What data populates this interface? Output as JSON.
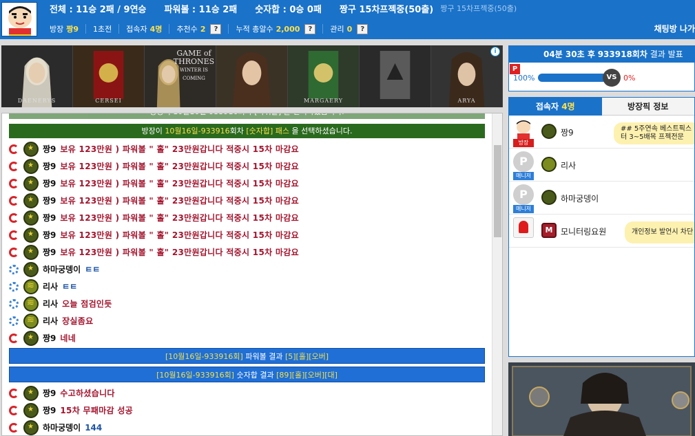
{
  "header": {
    "stats": {
      "total": "전체 : 11승 2패 / 9연승",
      "powerball": "파워볼 : 11승 2패",
      "numbers": "숫자합 : 0승 0패",
      "highlight": "짱구 15차프젝중(50출)",
      "highlight_dim": "짱구 15차프젝중(50출)"
    },
    "info": {
      "host_label": "방장",
      "host_name": "짱9",
      "class_label": "1초전",
      "users_label": "접속자",
      "users_value": "4명",
      "recommend_label": "추천수",
      "recommend_value": "2",
      "gift_label": "누적 총알수",
      "gift_value": "2,000",
      "manage_label": "관리",
      "manage_value": "0",
      "help_glyph": "?"
    },
    "chat_room_label": "채팅방 나가"
  },
  "ad": {
    "title_line1": "GAME of",
    "title_line2": "THRONES",
    "subtitle": "WINTER IS COMING",
    "characters": [
      "DAENERYS",
      "CERSEI",
      "MARGAERY",
      "ARYA"
    ],
    "info_glyph": "i"
  },
  "chat": {
    "system_top": "방장이 10월16일-933916회차 [파워볼] 을 선택하셨습니다.",
    "system": {
      "prefix": "방장이 ",
      "round": "10월16일-933916",
      "mid": "회차 ",
      "choice": "[숫자합] 패스",
      "suffix": " 을 선택하셨습니다."
    },
    "messages": [
      {
        "icon": "red",
        "rank": "star",
        "nick": "짱9",
        "text": "보유 123만원 ) 파워볼 \" 홀\" 23만원갑니다 적중시 15차 마감요",
        "style": "r"
      },
      {
        "icon": "red",
        "rank": "star",
        "nick": "짱9",
        "text": "보유 123만원 ) 파워볼 \" 홀\" 23만원갑니다 적중시 15차 마감요",
        "style": "r"
      },
      {
        "icon": "red",
        "rank": "star",
        "nick": "짱9",
        "text": "보유 123만원 ) 파워볼 \" 홀\" 23만원갑니다 적중시 15차 마감요",
        "style": "r"
      },
      {
        "icon": "red",
        "rank": "star",
        "nick": "짱9",
        "text": "보유 123만원 ) 파워볼 \" 홀\" 23만원갑니다 적중시 15차 마감요",
        "style": "r"
      },
      {
        "icon": "red",
        "rank": "star",
        "nick": "짱9",
        "text": "보유 123만원 ) 파워볼 \" 홀\" 23만원갑니다 적중시 15차 마감요",
        "style": "r"
      },
      {
        "icon": "red",
        "rank": "star",
        "nick": "짱9",
        "text": "보유 123만원 ) 파워볼 \" 홀\" 23만원갑니다 적중시 15차 마감요",
        "style": "r"
      },
      {
        "icon": "red",
        "rank": "star",
        "nick": "짱9",
        "text": "보유 123만원 ) 파워볼 \" 홀\" 23만원갑니다 적중시 15차 마감요",
        "style": "r"
      },
      {
        "icon": "blue",
        "rank": "star",
        "nick": "하마궁뎅이",
        "text": "ㅌㅌ",
        "style": "b"
      },
      {
        "icon": "blue",
        "rank": "chevron",
        "nick": "리사",
        "text": "ㅌㅌ",
        "style": "b"
      },
      {
        "icon": "blue",
        "rank": "chevron",
        "nick": "리사",
        "text": "오늘 점검인듯",
        "style": "r"
      },
      {
        "icon": "blue",
        "rank": "chevron",
        "nick": "리사",
        "text": "장실좀요",
        "style": "r"
      },
      {
        "icon": "red",
        "rank": "star",
        "nick": "짱9",
        "text": "네네",
        "style": "r"
      }
    ],
    "results": [
      {
        "round": "[10월16일-933916회]",
        "label": " 파워볼 결과 ",
        "num": "[5]",
        "odd": "[홀]",
        "size": "[오버]",
        "extra": ""
      },
      {
        "round": "[10월16일-933916회]",
        "label": " 숫자합 결과 ",
        "num": "[89]",
        "odd": "[홀]",
        "size": "[오버]",
        "extra": "[대]"
      }
    ],
    "messages2": [
      {
        "icon": "red",
        "rank": "star",
        "nick": "짱9",
        "text": "수고하셨습니다",
        "style": "r"
      },
      {
        "icon": "red",
        "rank": "star",
        "nick": "짱9",
        "text": "15차 무패마감 성공",
        "style": "r"
      },
      {
        "icon": "red",
        "rank": "star",
        "nick": "하마궁뎅이",
        "text": "144",
        "style": "b"
      }
    ]
  },
  "result_panel": {
    "time": "04분 30초 후",
    "round": "933918회차",
    "suffix": "결과 발표",
    "power_glyph": "P",
    "left_pct": "100%",
    "vs": "VS",
    "right_pct": "0%"
  },
  "users_panel": {
    "tab_users": "접속자",
    "tab_users_count": "4명",
    "tab_picks": "방장픽 정보",
    "users": [
      {
        "name": "짱9",
        "badge": "방장",
        "bubble": "## 5주연속 베스트픽스터 3~5배목 프젝전문",
        "avatar": "photo",
        "rank": "star"
      },
      {
        "name": "리사",
        "badge": "매니저",
        "bubble": "",
        "avatar": "P",
        "rank": "chevron"
      },
      {
        "name": "하마궁뎅이",
        "badge": "매니저",
        "bubble": "",
        "avatar": "P",
        "rank": "star"
      },
      {
        "name": "모니터링요원",
        "badge": "",
        "bubble": "개인정보 발언시 차단",
        "avatar": "siren",
        "rank": "M"
      }
    ]
  },
  "colors": {
    "brand": "#1a72c9",
    "system_green": "#2a6a1e",
    "result_blue": "#1f6fd6",
    "msg_red": "#a4152e"
  }
}
